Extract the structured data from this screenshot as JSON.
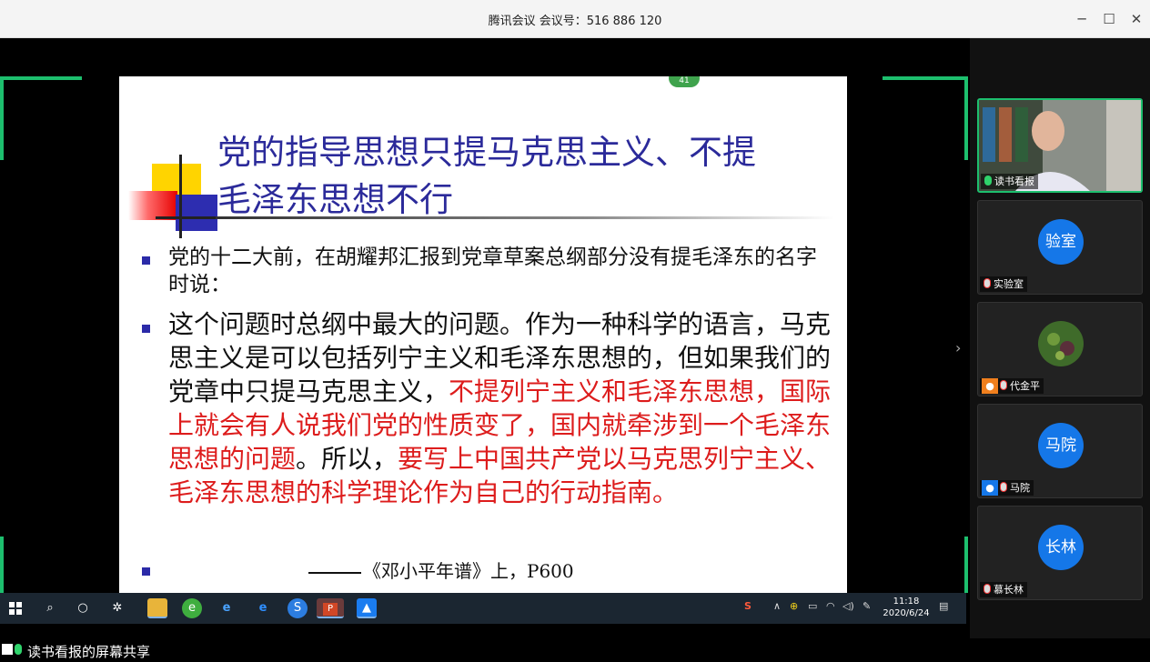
{
  "window": {
    "title": "腾讯会议 会议号：516 886 120",
    "minimize": "─",
    "maximize": "☐",
    "close": "✕"
  },
  "slide": {
    "page_badge": "41",
    "title_line1": "党的指导思想只提马克思主义、不提",
    "title_line2": "毛泽东思想不行",
    "bullet1": "党的十二大前，在胡耀邦汇报到党章草案总纲部分没有提毛泽东的名字时说：",
    "bullet2_black": "这个问题时总纲中最大的问题。作为一种科学的语言，马克思主义是可以包括列宁主义和毛泽东思想的，但如果我们的党章中只提马克思主义，",
    "bullet2_red1": "不提列宁主义和毛泽东思想，国际上就会有人说我们党的性质变了，国内就牵涉到一个毛泽东思想的问题",
    "bullet2_mid": "。所以，",
    "bullet2_red2": "要写上中国共产党以马克思列宁主义、毛泽东思想的科学理论作为自己的行动指南。",
    "citation": "《邓小平年谱》上，P600"
  },
  "taskbar": {
    "icons": [
      "start-icon",
      "search-icon",
      "cortana-icon",
      "task-view-icon",
      "file-explorer-icon",
      "browser-360-icon",
      "ie-icon",
      "edge-icon",
      "sogou-browser-icon",
      "powerpoint-icon",
      "tencent-meeting-icon"
    ],
    "clock_time": "11:18",
    "clock_date": "2020/6/24"
  },
  "status": {
    "share_text": "读书看报的屏幕共享"
  },
  "participants": [
    {
      "name": "读书看报",
      "avatar_text": "",
      "mic": "on",
      "active": true,
      "video": true
    },
    {
      "name": "实验室",
      "avatar_text": "验室",
      "mic": "off",
      "active": false
    },
    {
      "name": "代金平",
      "avatar_text": "",
      "mic": "off",
      "active": false,
      "photo": true
    },
    {
      "name": "马院",
      "avatar_text": "马院",
      "mic": "off",
      "active": false
    },
    {
      "name": "慕长林",
      "avatar_text": "长林",
      "mic": "off",
      "active": false
    }
  ],
  "colors": {
    "accent_green": "#1dbf6e",
    "avatar_blue": "#1577e8",
    "slide_title": "#2b2a9a",
    "slide_red": "#dd1c1c"
  }
}
